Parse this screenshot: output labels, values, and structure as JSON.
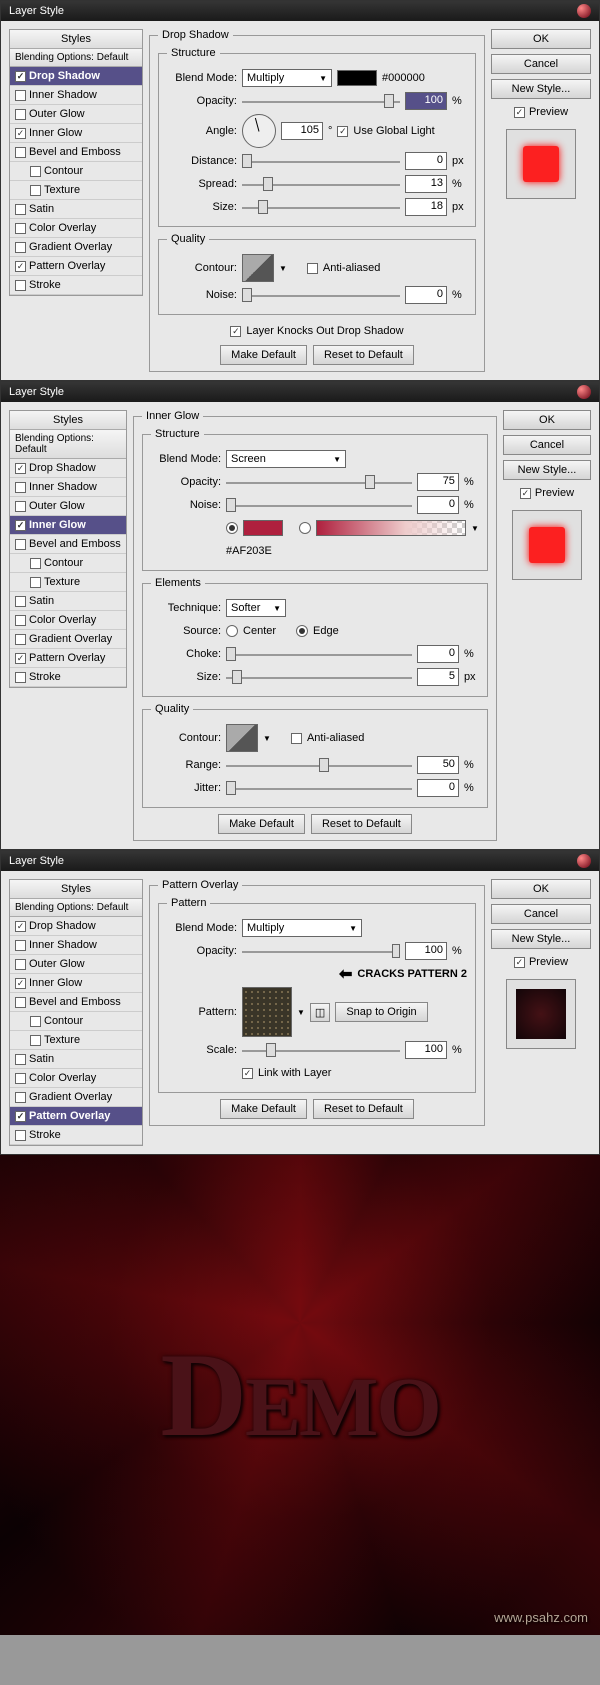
{
  "title": "Layer Style",
  "styles_header": "Styles",
  "blending": "Blending Options: Default",
  "items": [
    "Drop Shadow",
    "Inner Shadow",
    "Outer Glow",
    "Inner Glow",
    "Bevel and Emboss",
    "Contour",
    "Texture",
    "Satin",
    "Color Overlay",
    "Gradient Overlay",
    "Pattern Overlay",
    "Stroke"
  ],
  "buttons": {
    "ok": "OK",
    "cancel": "Cancel",
    "new": "New Style...",
    "preview": "Preview",
    "make": "Make Default",
    "reset": "Reset to Default",
    "snap": "Snap to Origin"
  },
  "d1": {
    "title": "Drop Shadow",
    "structure": "Structure",
    "quality": "Quality",
    "blend": "Blend Mode:",
    "mode": "Multiply",
    "hex": "#000000",
    "opacity_l": "Opacity:",
    "opacity": "100",
    "pct": "%",
    "angle_l": "Angle:",
    "angle": "105",
    "deg": "°",
    "global": "Use Global Light",
    "dist_l": "Distance:",
    "dist": "0",
    "px": "px",
    "spread_l": "Spread:",
    "spread": "13",
    "size_l": "Size:",
    "size": "18",
    "contour_l": "Contour:",
    "aa": "Anti-aliased",
    "noise_l": "Noise:",
    "noise": "0",
    "knock": "Layer Knocks Out Drop Shadow"
  },
  "d2": {
    "title": "Inner Glow",
    "structure": "Structure",
    "elements": "Elements",
    "quality": "Quality",
    "blend": "Blend Mode:",
    "mode": "Screen",
    "opacity_l": "Opacity:",
    "opacity": "75",
    "pct": "%",
    "noise_l": "Noise:",
    "noise": "0",
    "hex": "#AF203E",
    "tech_l": "Technique:",
    "tech": "Softer",
    "source_l": "Source:",
    "center": "Center",
    "edge": "Edge",
    "choke_l": "Choke:",
    "choke": "0",
    "size_l": "Size:",
    "size": "5",
    "px": "px",
    "contour_l": "Contour:",
    "aa": "Anti-aliased",
    "range_l": "Range:",
    "range": "50",
    "jitter_l": "Jitter:",
    "jitter": "0"
  },
  "d3": {
    "title": "Pattern Overlay",
    "pattern": "Pattern",
    "blend": "Blend Mode:",
    "mode": "Multiply",
    "opacity_l": "Opacity:",
    "opacity": "100",
    "pct": "%",
    "pattern_l": "Pattern:",
    "note": "CRACKS PATTERN 2",
    "scale_l": "Scale:",
    "scale": "100",
    "link": "Link with Layer"
  },
  "demo_text": "Demo",
  "wm": "www.psahz.com"
}
